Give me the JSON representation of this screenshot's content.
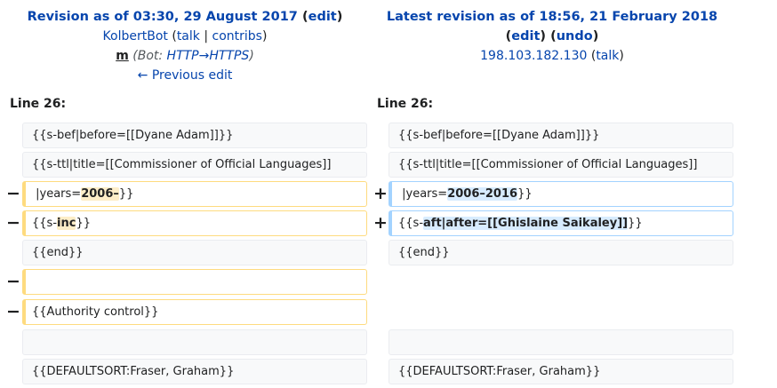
{
  "left_header": {
    "title_prefix": "Revision as of 03:30, 29 August 2017",
    "edit_link": "edit",
    "user": "KolbertBot",
    "talk": "talk",
    "sep": "|",
    "contribs": "contribs",
    "minor": "m",
    "summary_prefix": "Bot: ",
    "summary_link": "HTTP→HTTPS",
    "prev_link": "← Previous edit"
  },
  "right_header": {
    "title": "Latest revision as of 18:56, 21 February 2018",
    "edit_link": "edit",
    "undo_link": "undo",
    "user_ip": "198.103.182.130",
    "talk": "talk"
  },
  "line_left": "Line 26:",
  "line_right": "Line 26:",
  "rows": {
    "r1": {
      "left": "{{s-bef|before=[[Dyane Adam]]}}",
      "right": "{{s-bef|before=[[Dyane Adam]]}}"
    },
    "r2": {
      "left": "{{s-ttl|title=[[Commissioner of Official Languages]]",
      "right": "{{s-ttl|title=[[Commissioner of Official Languages]]"
    },
    "r3": {
      "left_a": "|years=",
      "left_b": "2006–",
      "left_c": "}}",
      "right_a": "|years=",
      "right_b": "2006–2016",
      "right_c": "}}"
    },
    "r4": {
      "left_a": "{{s-",
      "left_b": "inc",
      "left_c": "}}",
      "right_a": "{{s-",
      "right_b": "aft|after=[[Ghislaine Saikaley]]",
      "right_c": "}}"
    },
    "r5": {
      "left": "{{end}}",
      "right": "{{end}}"
    },
    "r7": {
      "left": "{{Authority control}}"
    },
    "r9": {
      "left": "{{DEFAULTSORT:Fraser, Graham}}",
      "right": "{{DEFAULTSORT:Fraser, Graham}}"
    }
  },
  "markers": {
    "minus": "−",
    "plus": "+"
  }
}
